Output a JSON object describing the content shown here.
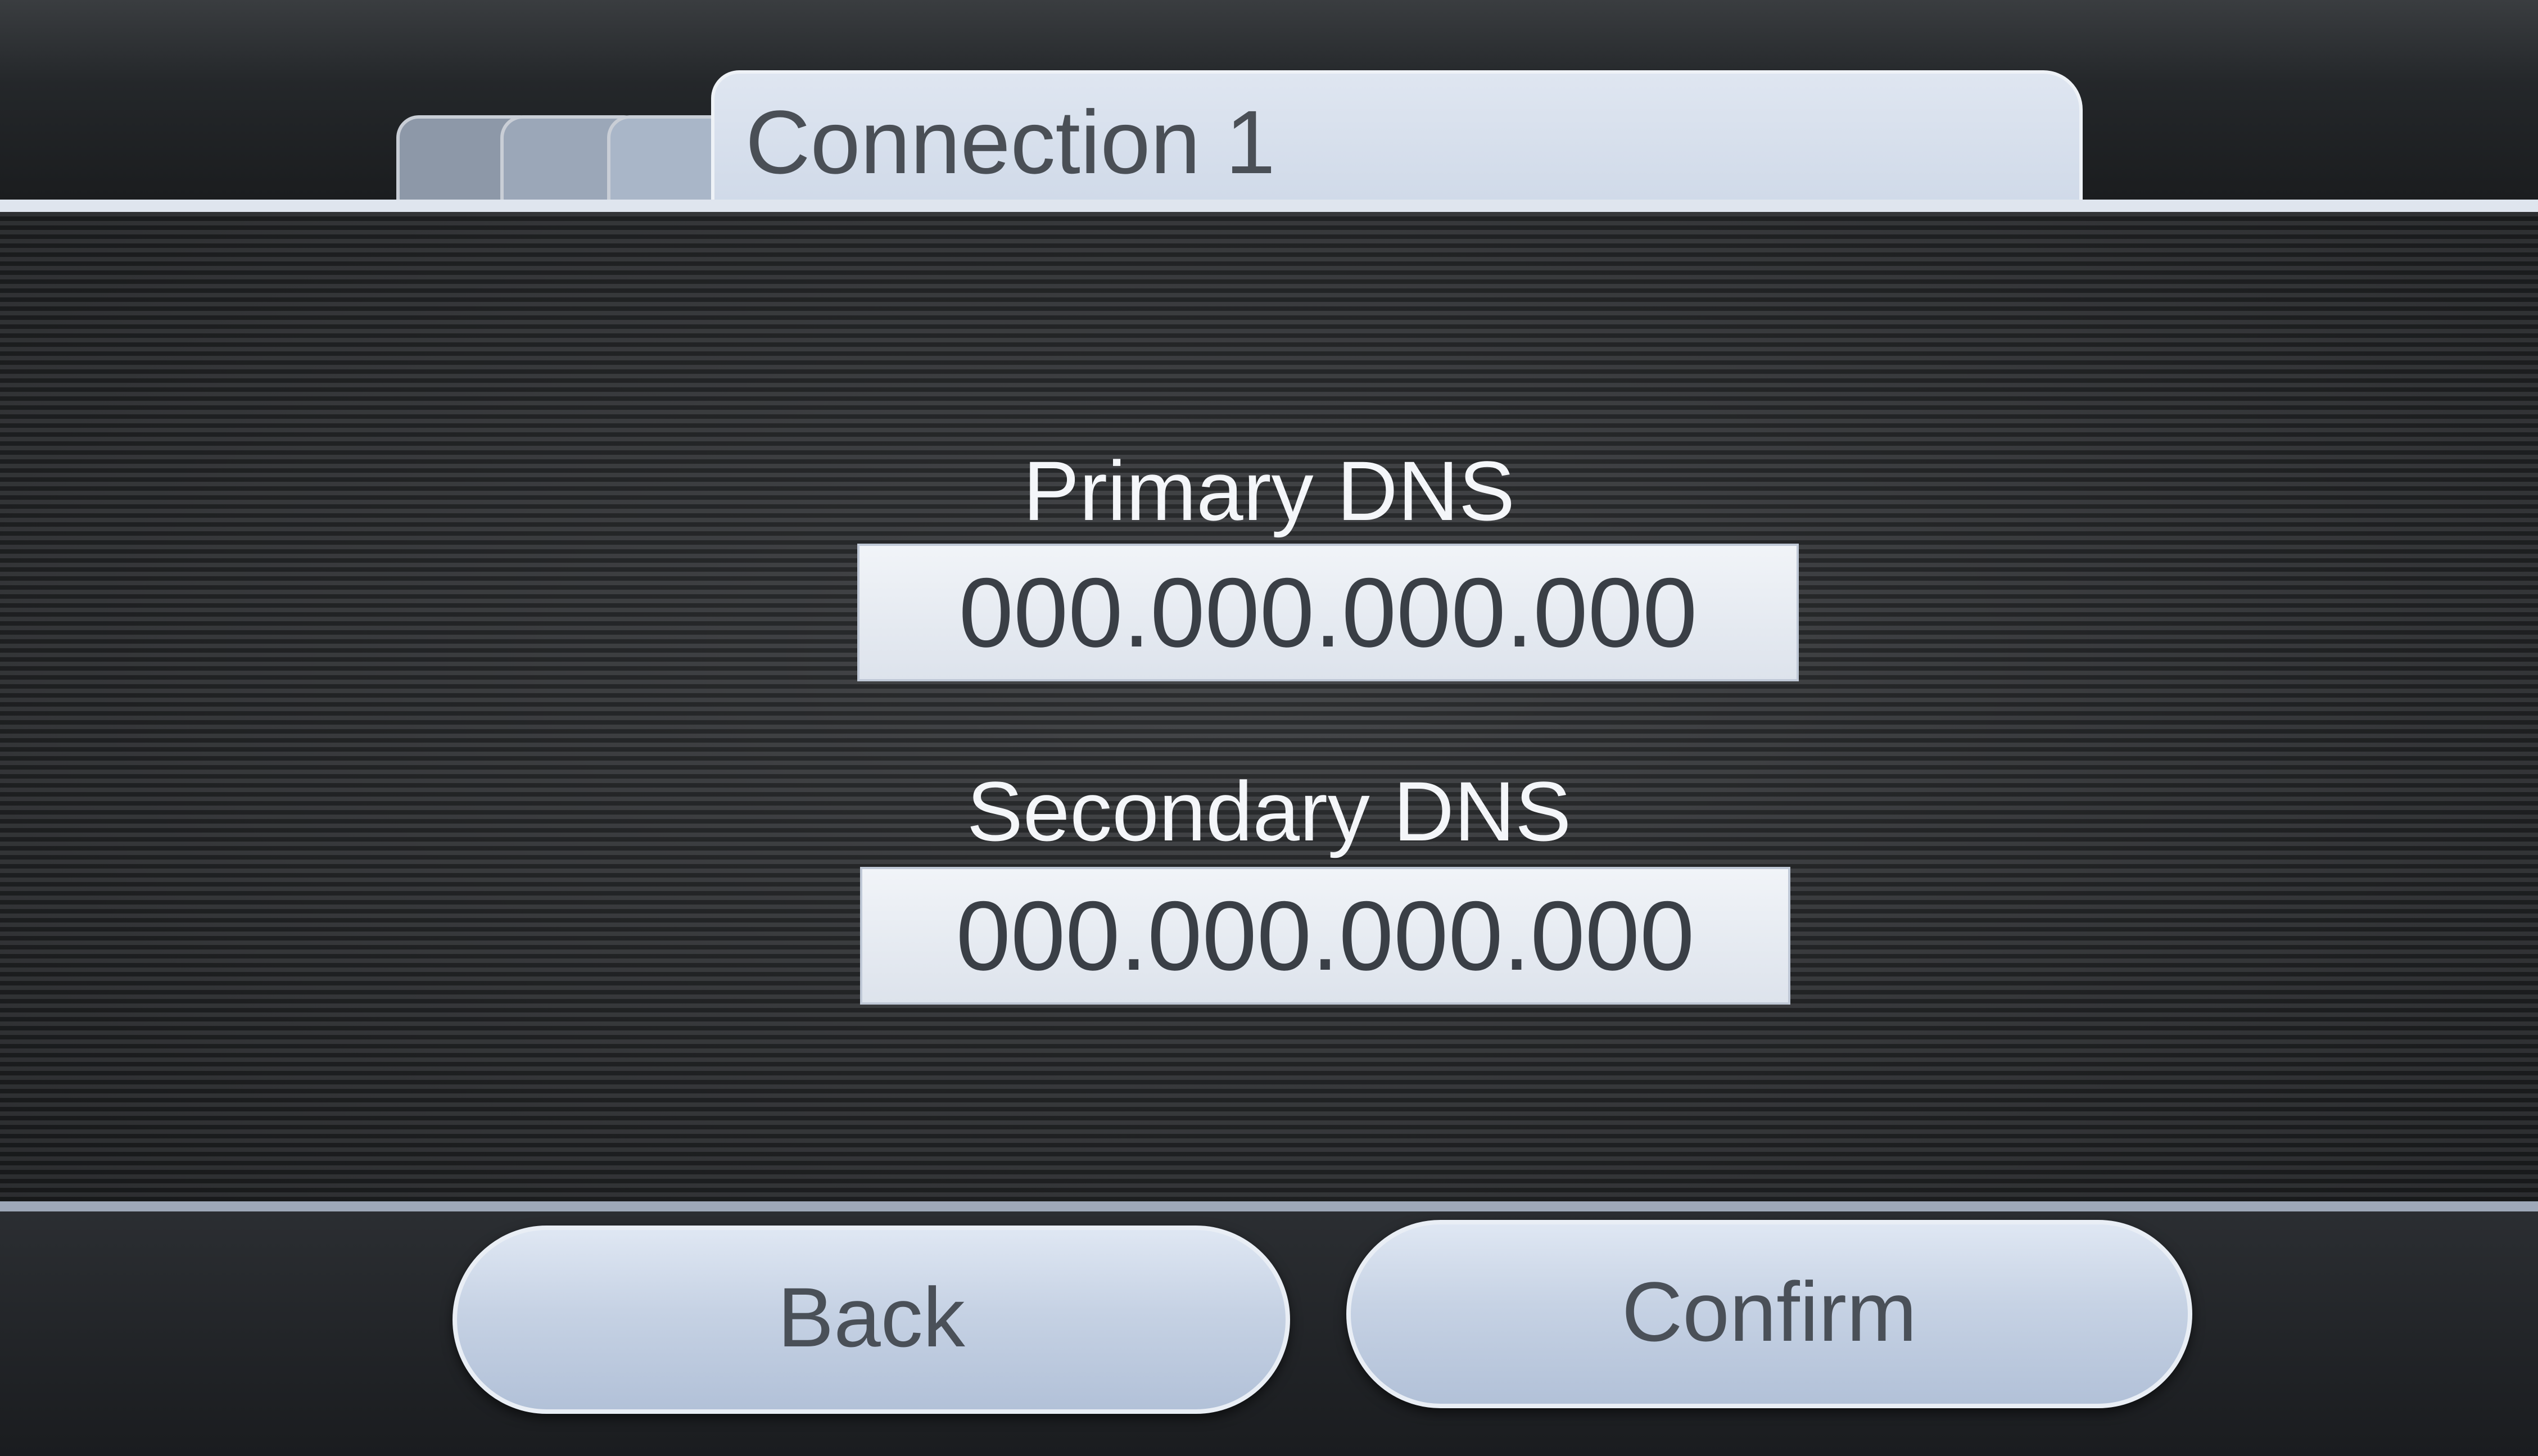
{
  "header": {
    "tab_title": "Connection 1"
  },
  "dns": {
    "primary_label": "Primary DNS",
    "primary_value": "000.000.000.000",
    "secondary_label": "Secondary DNS",
    "secondary_value": "000.000.000.000"
  },
  "footer": {
    "back_label": "Back",
    "confirm_label": "Confirm"
  },
  "colors": {
    "tab_active": "#d6dfec",
    "field_bg": "#e8edf4",
    "button_bg": "#c6d2e4",
    "panel_dark": "#1f2123"
  }
}
